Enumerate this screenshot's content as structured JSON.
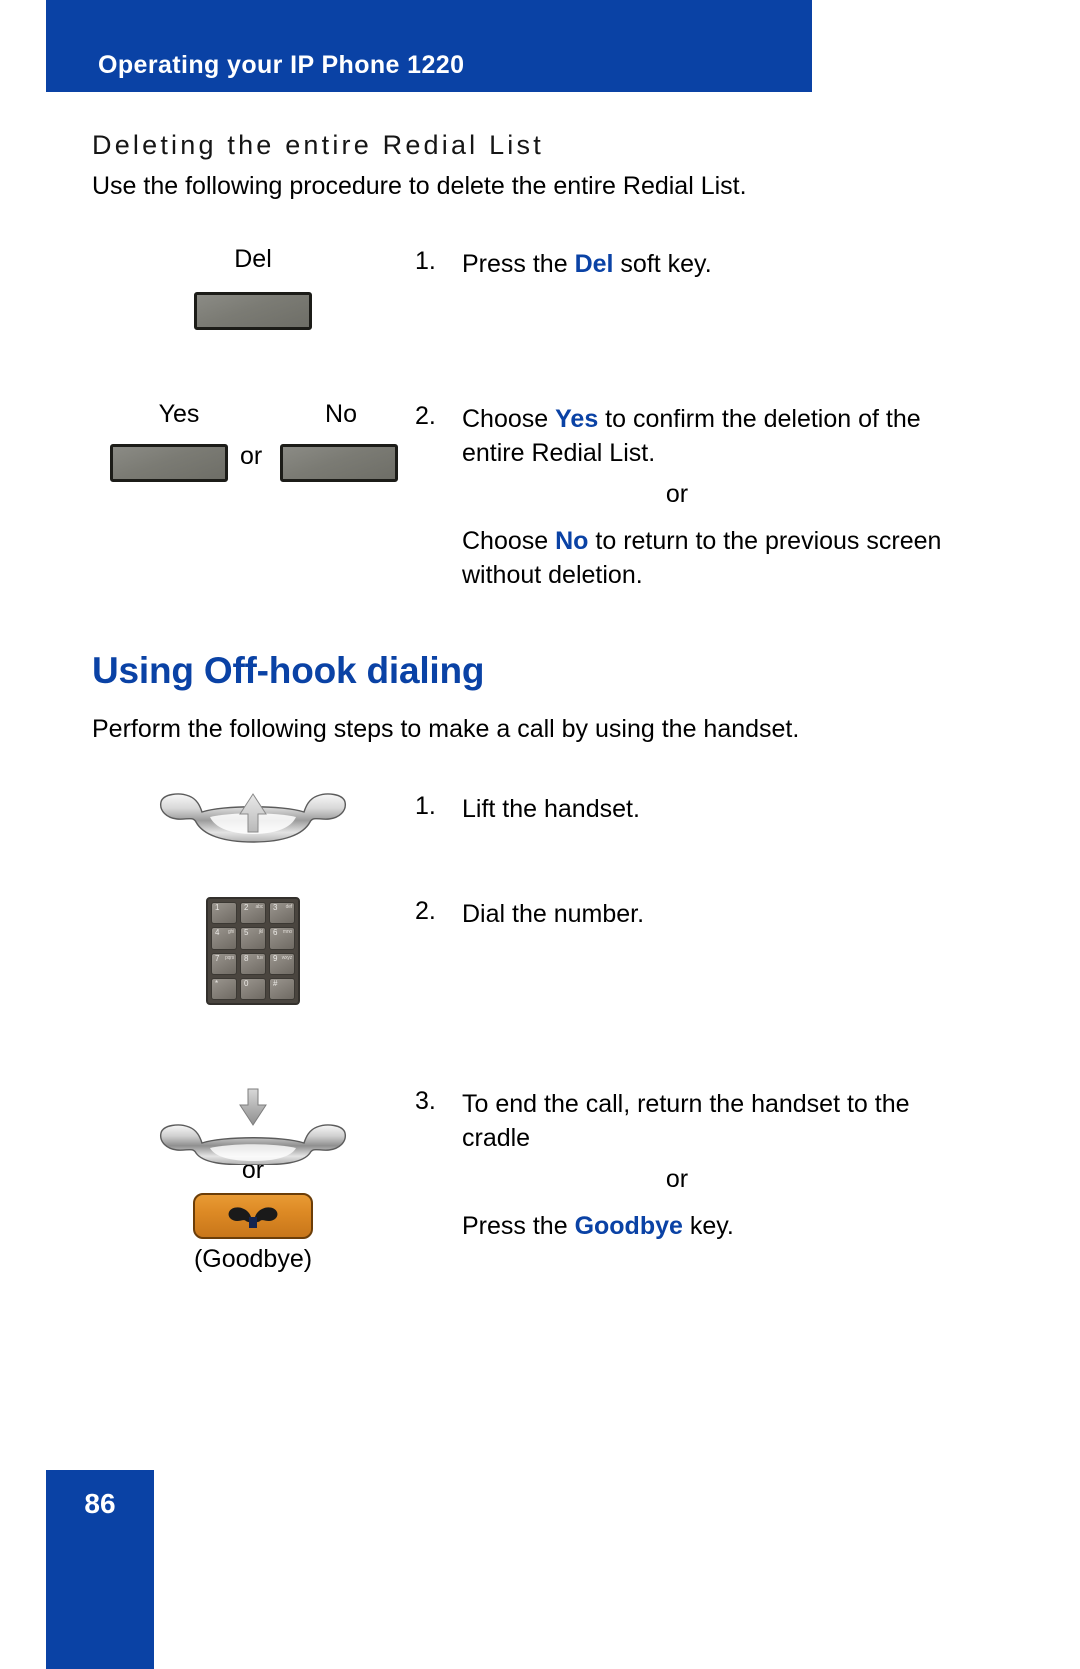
{
  "header": {
    "title": "Operating your IP Phone 1220",
    "banner_color": "#0a42a5"
  },
  "section": {
    "heading": "Deleting the entire Redial List",
    "intro": "Use the following procedure to delete the entire Redial List."
  },
  "redial_steps": [
    {
      "number": "1.",
      "text_before": "Press the ",
      "keyword": "Del",
      "text_after": " soft key.",
      "icon_label": "Del",
      "icon_type": "softkey"
    },
    {
      "number": "2.",
      "text_before": "Choose ",
      "keyword": "Yes",
      "text_after": " to confirm the deletion of the entire Redial List.",
      "or_label": "or",
      "alt_text_before": "Choose ",
      "alt_keyword": "No",
      "alt_text_after": " to return to the previous screen without deletion.",
      "icon_label_left": "Yes",
      "icon_label_right": "No",
      "icon_or": "or",
      "icon_type": "softkey-pair"
    }
  ],
  "offhook": {
    "heading": "Using Off-hook dialing",
    "heading_color": "#0a42a5",
    "intro": "Perform the following steps to make a call by using the handset.",
    "steps": [
      {
        "number": "1.",
        "text": "Lift the handset.",
        "icon_type": "handset-up"
      },
      {
        "number": "2.",
        "text": "Dial the number.",
        "icon_type": "keypad"
      },
      {
        "number": "3.",
        "text": "To end the call, return the handset to the cradle",
        "or_label": "or",
        "alt_text_before": "Press the ",
        "alt_keyword": "Goodbye",
        "alt_text_after": " key.",
        "icon_type": "handset-down-goodbye",
        "icon_or": "or",
        "icon_caption": "(Goodbye)"
      }
    ]
  },
  "keypad": {
    "keys": [
      {
        "digit": "1",
        "letters": ""
      },
      {
        "digit": "2",
        "letters": "abc"
      },
      {
        "digit": "3",
        "letters": "def"
      },
      {
        "digit": "4",
        "letters": "ghi"
      },
      {
        "digit": "5",
        "letters": "jkl"
      },
      {
        "digit": "6",
        "letters": "mno"
      },
      {
        "digit": "7",
        "letters": "pqrs"
      },
      {
        "digit": "8",
        "letters": "tuv"
      },
      {
        "digit": "9",
        "letters": "wxyz"
      },
      {
        "digit": "*",
        "letters": ""
      },
      {
        "digit": "0",
        "letters": ""
      },
      {
        "digit": "#",
        "letters": ""
      }
    ]
  },
  "footer": {
    "page_number": "86"
  }
}
